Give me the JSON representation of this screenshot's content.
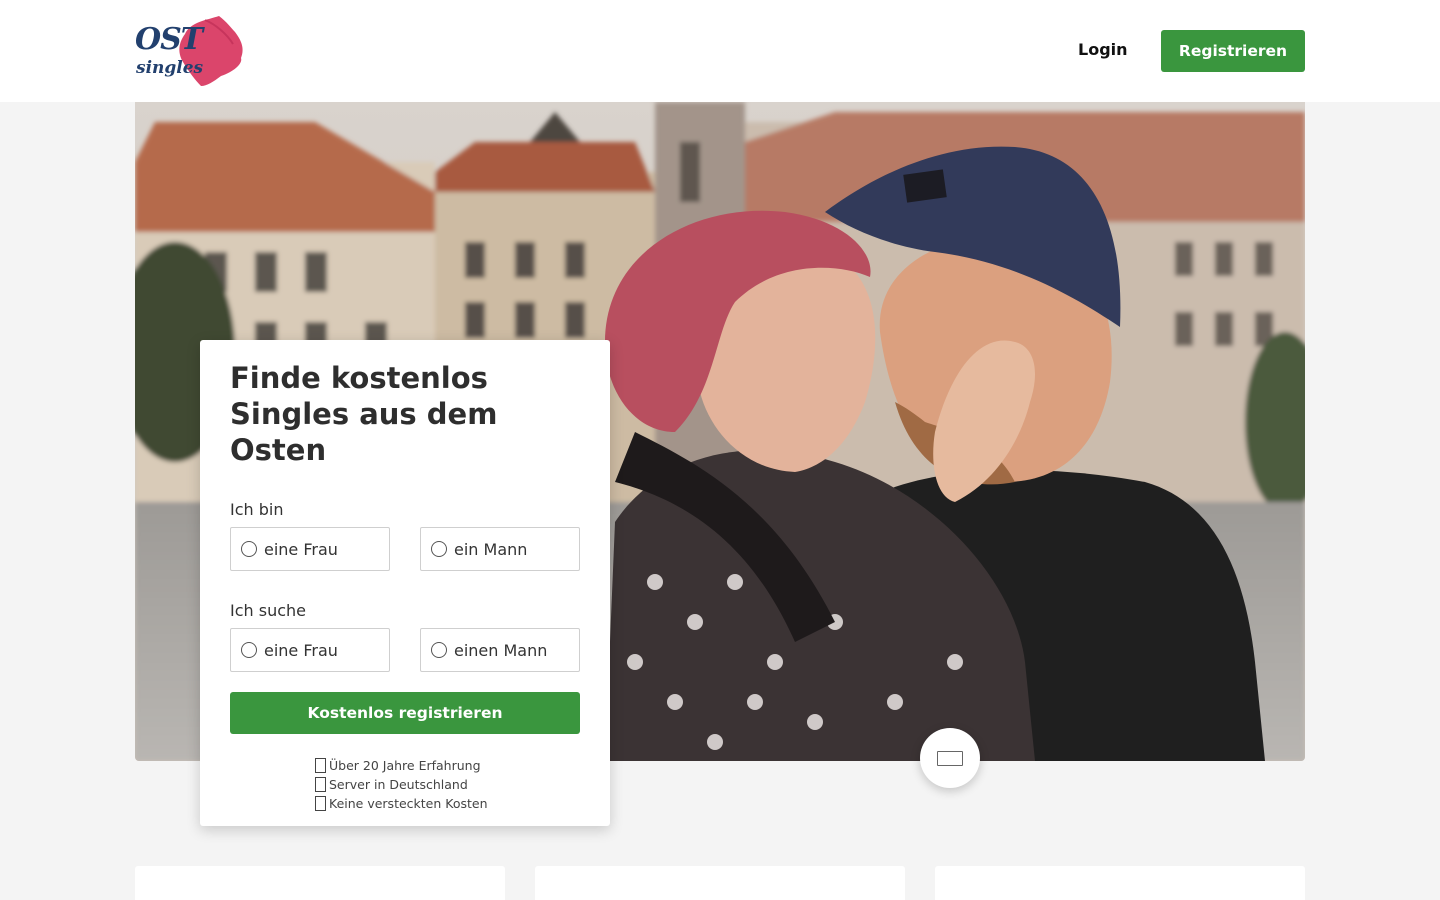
{
  "header": {
    "logo_text_top": "OST",
    "logo_text_bottom": "singles",
    "login_label": "Login",
    "register_label": "Registrieren",
    "brand_color": "#3a963e"
  },
  "signup": {
    "title": "Finde kostenlos Singles aus dem Osten",
    "i_am_label": "Ich bin",
    "i_am_options": [
      "eine Frau",
      "ein Mann"
    ],
    "seeking_label": "Ich suche",
    "seeking_options": [
      "eine Frau",
      "einen Mann"
    ],
    "submit_label": "Kostenlos registrieren",
    "benefits": [
      {
        "icon": "check-icon",
        "text": "Über 20 Jahre Erfahrung"
      },
      {
        "icon": "server-icon",
        "text": "Server in Deutschland"
      },
      {
        "icon": "tag-icon",
        "text": "Keine versteckten Kosten"
      }
    ]
  },
  "hero": {
    "image": "couple-embracing-old-town-photo"
  },
  "scroll_button": {
    "icon": "message-icon"
  }
}
